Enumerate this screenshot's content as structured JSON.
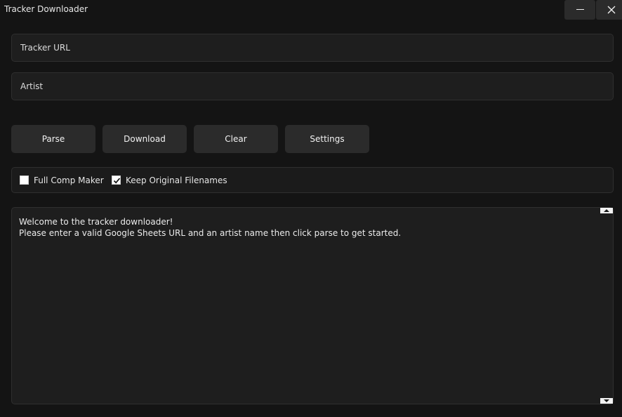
{
  "window": {
    "title": "Tracker Downloader",
    "controls": {
      "minimize_icon": "minimize-icon",
      "close_icon": "close-icon"
    }
  },
  "inputs": {
    "tracker_url": {
      "value": "",
      "placeholder": "Tracker URL"
    },
    "artist": {
      "value": "",
      "placeholder": "Artist"
    }
  },
  "buttons": {
    "parse": "Parse",
    "download": "Download",
    "clear": "Clear",
    "settings": "Settings"
  },
  "options": {
    "full_comp_maker": {
      "label": "Full Comp Maker",
      "checked": false
    },
    "keep_original_filenames": {
      "label": "Keep Original Filenames",
      "checked": true
    }
  },
  "log": {
    "lines": [
      "Welcome to the tracker downloader!",
      "Please enter a valid Google Sheets URL and an artist name then click parse to get started."
    ]
  },
  "colors": {
    "background": "#141414",
    "panel": "#1e1e1e",
    "button": "#2b2b2b",
    "text": "#ededed"
  }
}
